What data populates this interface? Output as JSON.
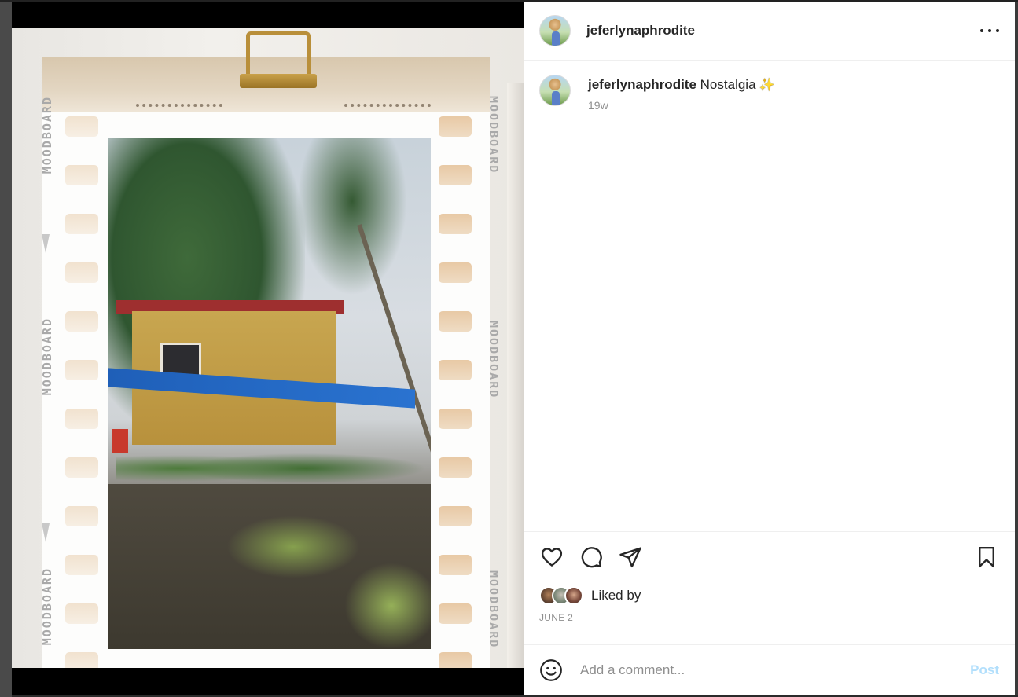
{
  "post": {
    "username": "jeferlynaphrodite",
    "media": {
      "side_text": "MOODBOARD"
    },
    "caption": {
      "username": "jeferlynaphrodite",
      "text": "Nostalgia",
      "emoji": "✨",
      "time": "19w"
    },
    "likes": {
      "label": "Liked by"
    },
    "date": "JUNE 2"
  },
  "comment_box": {
    "placeholder": "Add a comment...",
    "post_label": "Post"
  },
  "icons": {
    "more": "more-horizontal-icon",
    "like": "heart-icon",
    "comment": "comment-bubble-icon",
    "share": "paper-plane-icon",
    "save": "bookmark-icon",
    "emoji": "smiley-icon"
  },
  "colors": {
    "text": "#262626",
    "secondary": "#8e8e8e",
    "post_button_disabled": "#b2dffc",
    "divider": "#efefef",
    "media_background": "#000000"
  }
}
